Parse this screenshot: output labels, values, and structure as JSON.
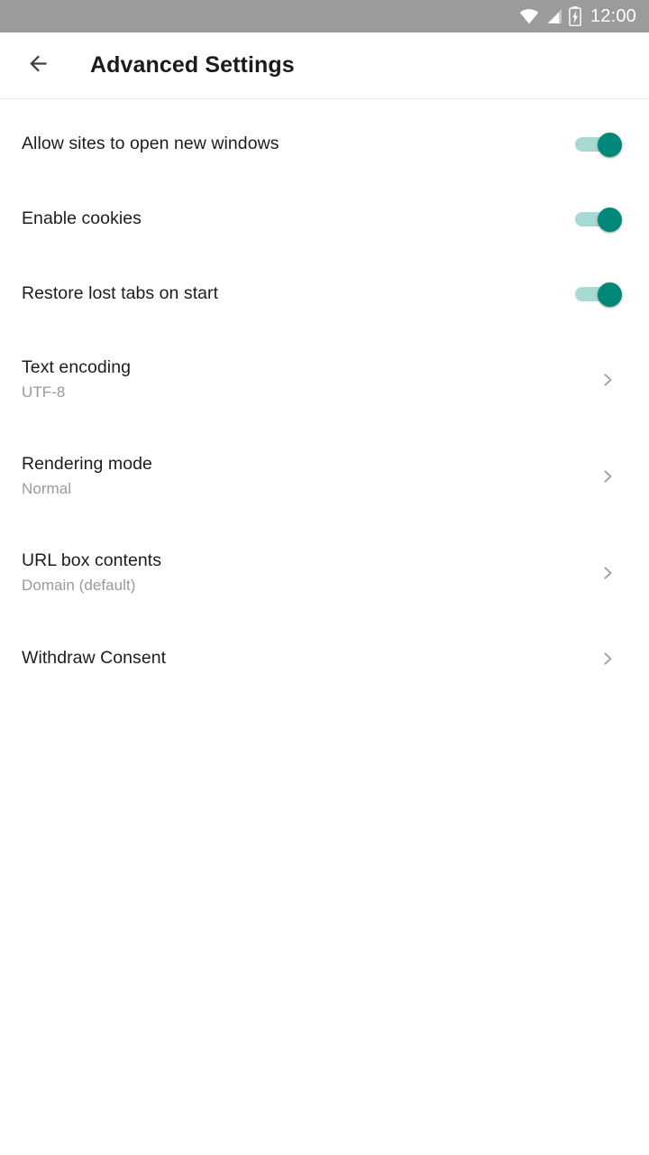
{
  "status_bar": {
    "background_color": "#9b9b9b",
    "clock": "12:00",
    "icons": [
      "wifi-icon",
      "cell-signal-icon",
      "battery-charging-icon"
    ]
  },
  "app_bar": {
    "back_icon": "arrow-left-icon",
    "title": "Advanced Settings"
  },
  "theme": {
    "accent_color": "#00897b",
    "track_color": "#a8d9d3",
    "title_color": "#1d1d1d",
    "subtitle_color": "#9a9a9a",
    "chevron_color": "#9e9e9e"
  },
  "settings": [
    {
      "id": "allow-new-windows",
      "type": "switch",
      "title": "Allow sites to open new windows",
      "subtitle": "",
      "value": "on"
    },
    {
      "id": "enable-cookies",
      "type": "switch",
      "title": "Enable cookies",
      "subtitle": "",
      "value": "on"
    },
    {
      "id": "restore-lost-tabs",
      "type": "switch",
      "title": "Restore lost tabs on start",
      "subtitle": "",
      "value": "on"
    },
    {
      "id": "text-encoding",
      "type": "nav",
      "title": "Text encoding",
      "subtitle": "UTF-8",
      "value": "UTF-8"
    },
    {
      "id": "rendering-mode",
      "type": "nav",
      "title": "Rendering mode",
      "subtitle": "Normal",
      "value": "Normal"
    },
    {
      "id": "url-box-contents",
      "type": "nav",
      "title": "URL box contents",
      "subtitle": "Domain (default)",
      "value": "Domain (default)"
    },
    {
      "id": "withdraw-consent",
      "type": "nav",
      "title": "Withdraw Consent",
      "subtitle": "",
      "value": ""
    }
  ]
}
